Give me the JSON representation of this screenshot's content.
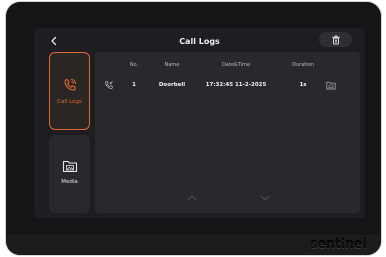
{
  "header": {
    "title": "Call Logs"
  },
  "sidebar": {
    "call_logs_label": "Call Logs",
    "media_label": "Media"
  },
  "table": {
    "columns": [
      "No.",
      "Name",
      "Date&Time",
      "Duration"
    ],
    "rows": [
      {
        "no": "1",
        "name": "Doorbell",
        "datetime": "17:32:45 11-2-2025",
        "duration": "1s"
      }
    ]
  },
  "brand": {
    "name": "sentinel"
  },
  "colors": {
    "accent": "#e3682f",
    "panel": "#29292d",
    "screen": "#1e1e22"
  },
  "icons": [
    "back-icon",
    "trash-icon",
    "phone-ring-icon",
    "folder-image-icon",
    "call-incoming-icon",
    "folder-icon",
    "chevron-up-icon",
    "chevron-down-icon"
  ]
}
